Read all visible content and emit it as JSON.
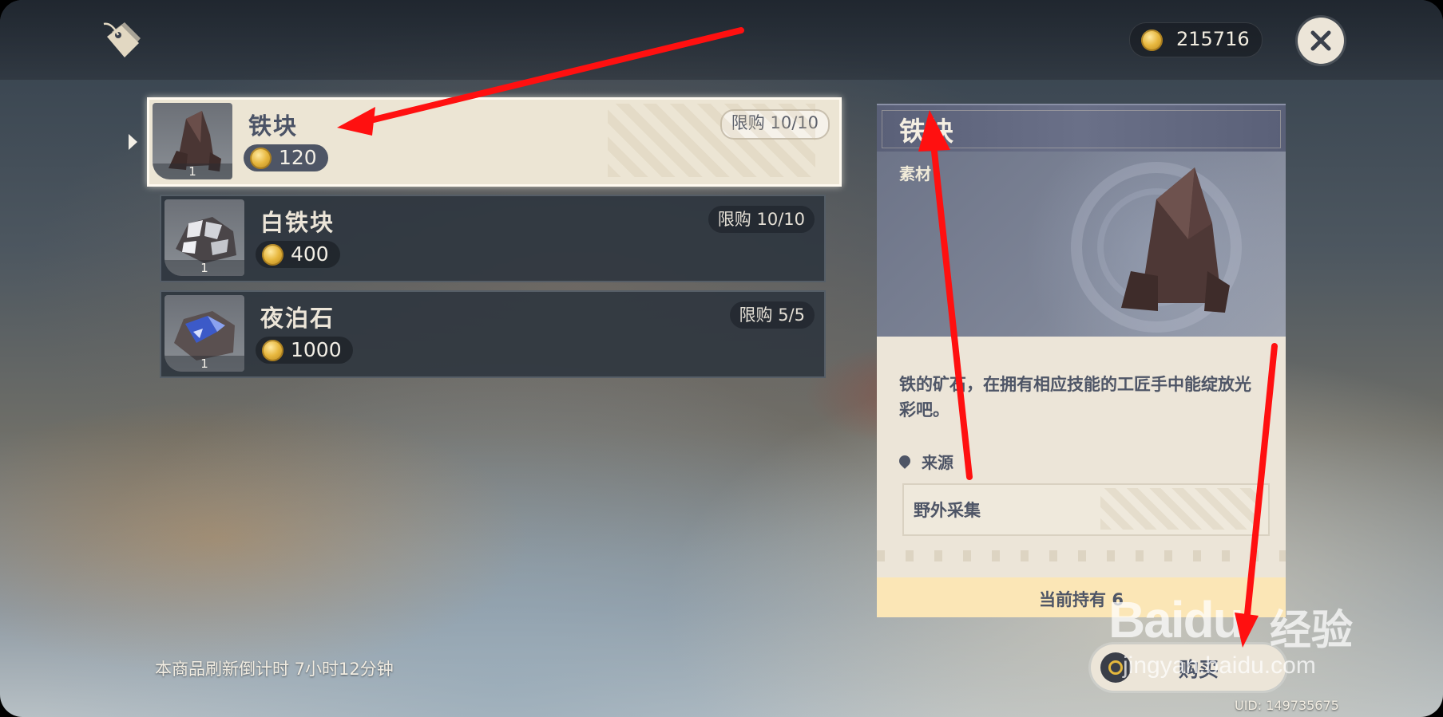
{
  "currency": {
    "value": "215716"
  },
  "items": [
    {
      "name": "铁块",
      "price": "120",
      "limit": "限购 10/10",
      "qty": "1",
      "selected": true
    },
    {
      "name": "白铁块",
      "price": "400",
      "limit": "限购 10/10",
      "qty": "1",
      "selected": false
    },
    {
      "name": "夜泊石",
      "price": "1000",
      "limit": "限购 5/5",
      "qty": "1",
      "selected": false
    }
  ],
  "detail": {
    "title": "铁块",
    "type": "素材",
    "description": "铁的矿石，在拥有相应技能的工匠手中能绽放光彩吧。",
    "source_label": "来源",
    "source": "野外采集",
    "holding": "当前持有 6"
  },
  "buy_button": {
    "label": "购买"
  },
  "refresh": {
    "text": "本商品刷新倒计时 7小时12分钟"
  },
  "uid": "UID: 149735675",
  "watermark": {
    "brand": "Baidu",
    "cn": "经验",
    "url": "jingyan.baidu.com"
  },
  "icons": [
    "shop-tag-icon",
    "mora-coin-icon",
    "close-icon",
    "location-pin-icon"
  ],
  "colors": {
    "accent_selected": "#ece5d4",
    "panel_header": "#5a6078",
    "annotation_arrow": "#ff1010"
  }
}
